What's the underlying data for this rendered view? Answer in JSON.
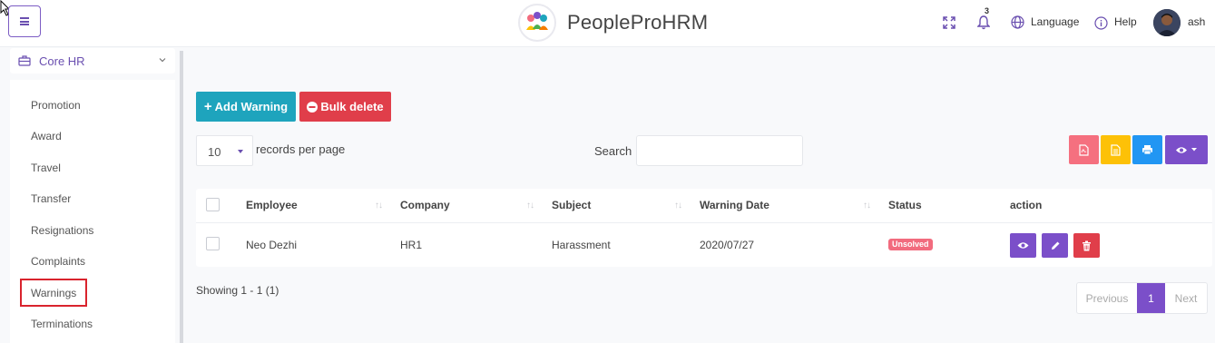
{
  "header": {
    "brand": "PeopleProHRM",
    "notification_count": "3",
    "language_label": "Language",
    "help_label": "Help",
    "user_name": "ash"
  },
  "sidebar": {
    "section_label": "Core HR",
    "items": [
      {
        "label": "Promotion"
      },
      {
        "label": "Award"
      },
      {
        "label": "Travel"
      },
      {
        "label": "Transfer"
      },
      {
        "label": "Resignations"
      },
      {
        "label": "Complaints"
      },
      {
        "label": "Warnings"
      },
      {
        "label": "Terminations"
      }
    ]
  },
  "toolbar": {
    "add_label": "Add Warning",
    "bulk_delete_label": "Bulk delete"
  },
  "table_controls": {
    "page_length": "10",
    "records_label": "records per page",
    "search_label": "Search",
    "search_value": ""
  },
  "table": {
    "columns": [
      "Employee",
      "Company",
      "Subject",
      "Warning Date",
      "Status",
      "action"
    ],
    "rows": [
      {
        "employee": "Neo Dezhi",
        "company": "HR1",
        "subject": "Harassment",
        "warning_date": "2020/07/27",
        "status": "Unsolved"
      }
    ]
  },
  "pagination": {
    "showing": "Showing 1 - 1 (1)",
    "previous": "Previous",
    "current": "1",
    "next": "Next"
  },
  "colors": {
    "accent": "#7b4fc9",
    "add_button": "#1ea4bd",
    "delete_button": "#e03e4a",
    "pdf": "#f5707f",
    "csv": "#fdc107",
    "print": "#2196f3",
    "status_unsolved": "#f26b7e"
  }
}
